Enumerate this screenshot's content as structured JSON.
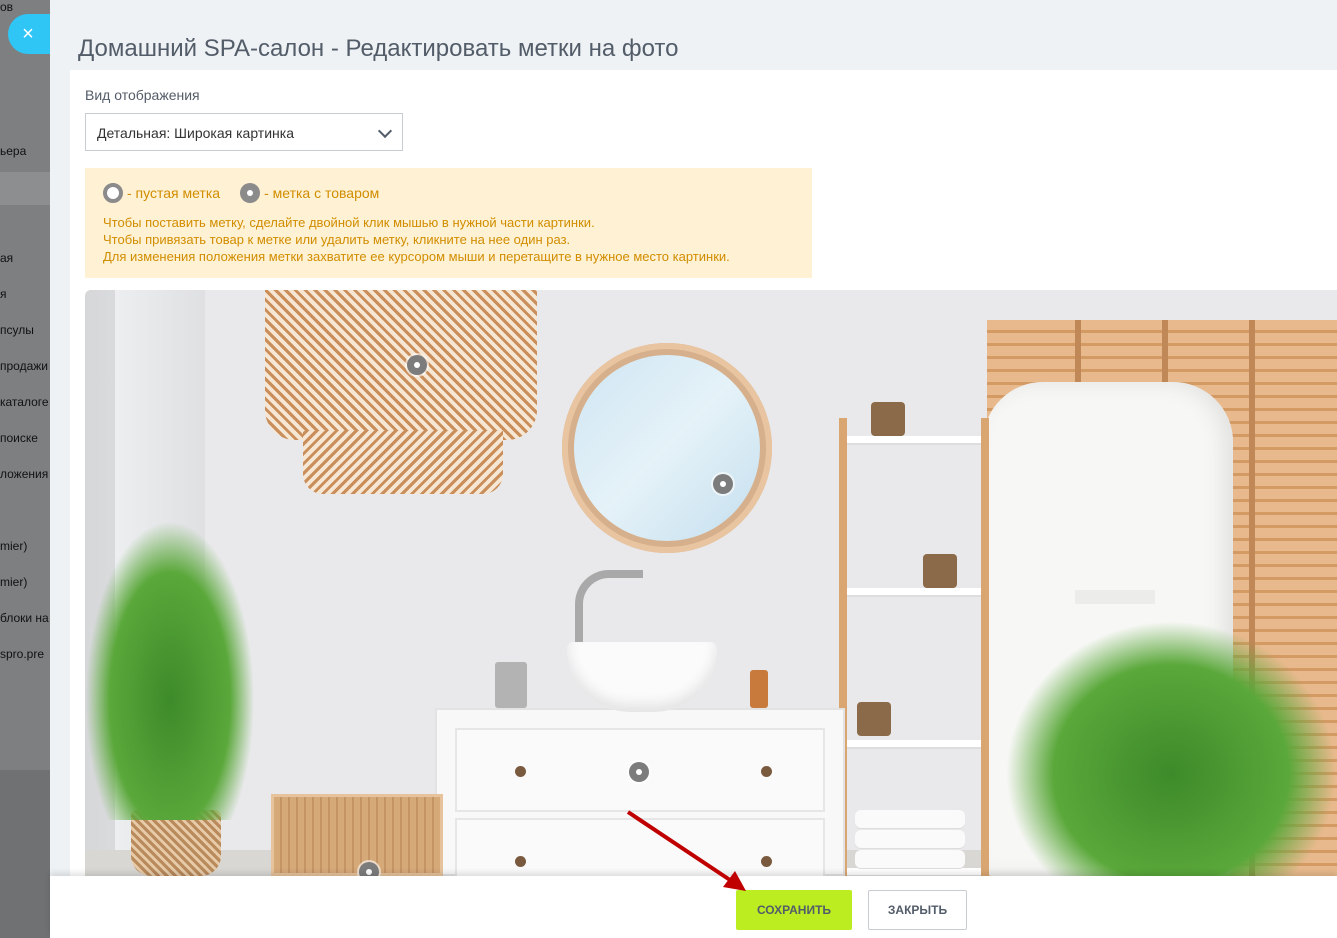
{
  "background_menu": {
    "items": [
      "ов",
      "ьера",
      "ая",
      "я",
      "псулы",
      "продажи",
      "каталоге",
      "поиске",
      "ложения",
      "mier)",
      "mier)",
      "блоки на",
      "spro.pre"
    ]
  },
  "close_button": {
    "icon": "close-icon",
    "glyph": "×"
  },
  "slider": {
    "title": "Домашний SPA-салон - Редактировать метки на фото",
    "display_label": "Вид отображения",
    "display_select": {
      "value": "Детальная: Широкая картинка"
    },
    "legend": {
      "empty_tag": "- пустая метка",
      "product_tag": "- метка с товаром"
    },
    "hints": [
      "Чтобы поставить метку, сделайте двойной клик мышью в нужной части картинки.",
      "Чтобы привязать товар к метке или удалить метку, кликните на нее один раз.",
      "Для изменения положения метки захватите ее курсором мыши и перетащите в нужное место картинки."
    ],
    "colors": {
      "accent": "#2fc6f6",
      "save": "#bbed21",
      "hint_bg": "#fff1d3",
      "hint_text": "#d18d00",
      "arrow": "#c00000"
    }
  },
  "footer": {
    "save_label": "СОХРАНИТЬ",
    "close_label": "ЗАКРЫТЬ"
  }
}
